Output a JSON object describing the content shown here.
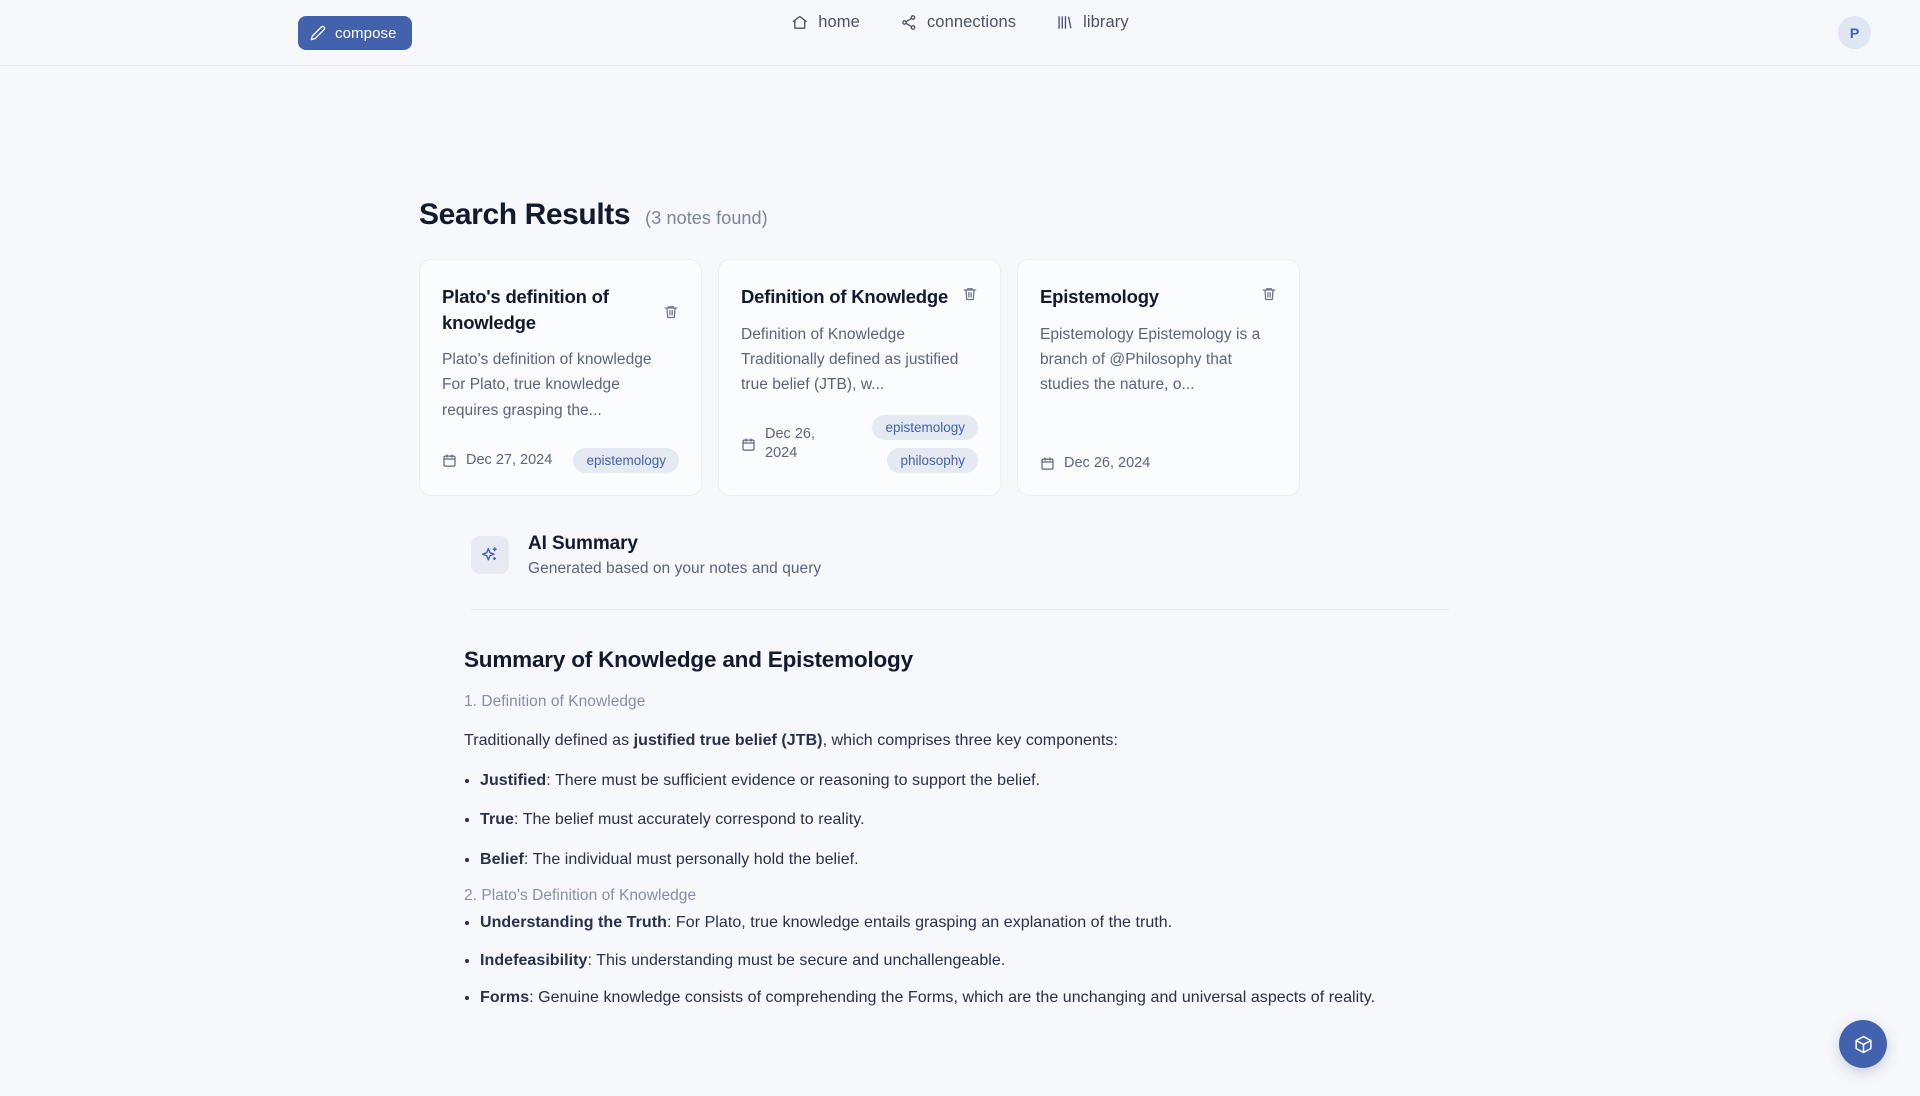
{
  "topbar": {
    "compose_label": "compose",
    "nav": [
      {
        "label": "home",
        "icon": "home-icon"
      },
      {
        "label": "connections",
        "icon": "connections-icon"
      },
      {
        "label": "library",
        "icon": "library-icon"
      }
    ],
    "avatar_initial": "P"
  },
  "results": {
    "title": "Search Results",
    "count_label": "(3 notes found)",
    "cards": [
      {
        "title": "Plato's definition of knowledge",
        "snippet": "Plato's definition of knowledge For Plato, true knowledge requires grasping the...",
        "date": "Dec 27, 2024",
        "tags": [
          "epistemology"
        ]
      },
      {
        "title": "Definition of Knowledge",
        "snippet": "Definition of Knowledge Traditionally defined as justified true belief (JTB), w...",
        "date": "Dec 26, 2024",
        "tags": [
          "epistemology",
          "philosophy"
        ]
      },
      {
        "title": "Epistemology",
        "snippet": "Epistemology Epistemology is a branch of @Philosophy that studies the nature, o...",
        "date": "Dec 26, 2024",
        "tags": []
      }
    ]
  },
  "ai_summary": {
    "heading": "AI Summary",
    "subheading": "Generated based on your notes and query",
    "body": {
      "h1": "Summary of Knowledge and Epistemology",
      "section1_heading": "1. Definition of Knowledge",
      "section1_intro_pre": "Traditionally defined as ",
      "section1_intro_bold": "justified true belief (JTB)",
      "section1_intro_post": ", which comprises three key components:",
      "section1_bullets": [
        {
          "term": "Justified",
          "text": ": There must be sufficient evidence or reasoning to support the belief."
        },
        {
          "term": "True",
          "text": ": The belief must accurately correspond to reality."
        },
        {
          "term": "Belief",
          "text": ": The individual must personally hold the belief."
        }
      ],
      "section2_heading": "2. Plato's Definition of Knowledge",
      "section2_bullets": [
        {
          "term": "Understanding the Truth",
          "text": ": For Plato, true knowledge entails grasping an explanation of the truth."
        },
        {
          "term": "Indefeasibility",
          "text": ": This understanding must be secure and unchallengeable."
        },
        {
          "term": "Forms",
          "text": ": Genuine knowledge consists of comprehending the Forms, which are the unchanging and universal aspects of reality."
        }
      ]
    }
  },
  "fab": {
    "icon": "cube-icon"
  },
  "colors": {
    "accent": "#4362ad",
    "page_bg": "#f7f8fb",
    "card_bg": "#fbfcfe",
    "tag_bg": "#e4e9f2",
    "text_primary": "#141a2e",
    "text_muted": "#5c6479"
  }
}
